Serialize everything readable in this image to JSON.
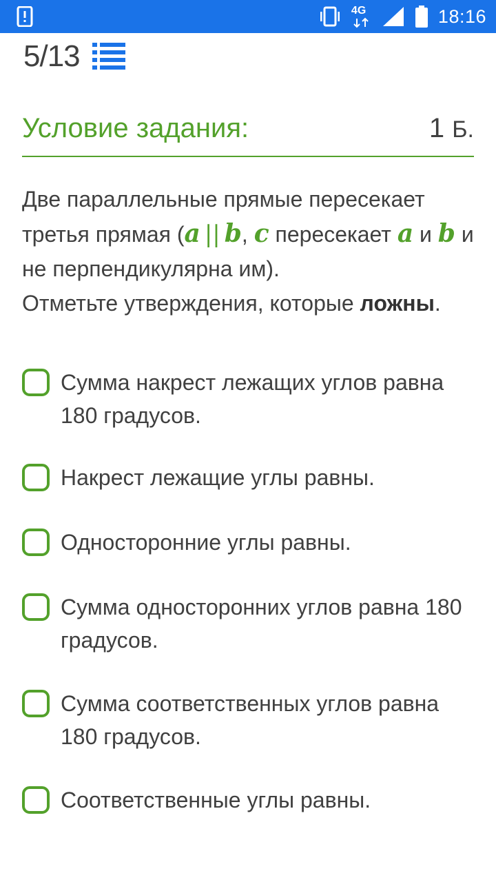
{
  "status_bar": {
    "network": "4G",
    "time": "18:16",
    "background_color": "#1a73e8"
  },
  "progress": {
    "counter": "5/13",
    "list_icon": "list-icon"
  },
  "task": {
    "heading": "Условие задания:",
    "score": "1",
    "score_unit": "Б.",
    "accent_color": "#53a12b"
  },
  "question": {
    "line1_prefix": "Две параллельные прямые пересекает третья прямая (",
    "var_a": "a",
    "parallel": "||",
    "var_b": "b",
    "comma": ",",
    "var_c": "c",
    "intersects": "пересекает",
    "var_a2": "a",
    "and": "и",
    "var_b2": "b",
    "suffix": "и не перпендикулярна им).",
    "instruction_prefix": "Отметьте утверждения, которые",
    "instruction_bold": "ложны",
    "instruction_end": "."
  },
  "options": [
    {
      "label": "Сумма накрест лежащих углов равна 180 градусов.",
      "checked": false
    },
    {
      "label": "Накрест лежащие углы равны.",
      "checked": false
    },
    {
      "label": "Односторонние углы равны.",
      "checked": false
    },
    {
      "label": "Сумма односторонних углов равна 180 градусов.",
      "checked": false
    },
    {
      "label": "Сумма соответственных углов равна 180 градусов.",
      "checked": false
    },
    {
      "label": "Соответственные углы равны.",
      "checked": false
    }
  ]
}
